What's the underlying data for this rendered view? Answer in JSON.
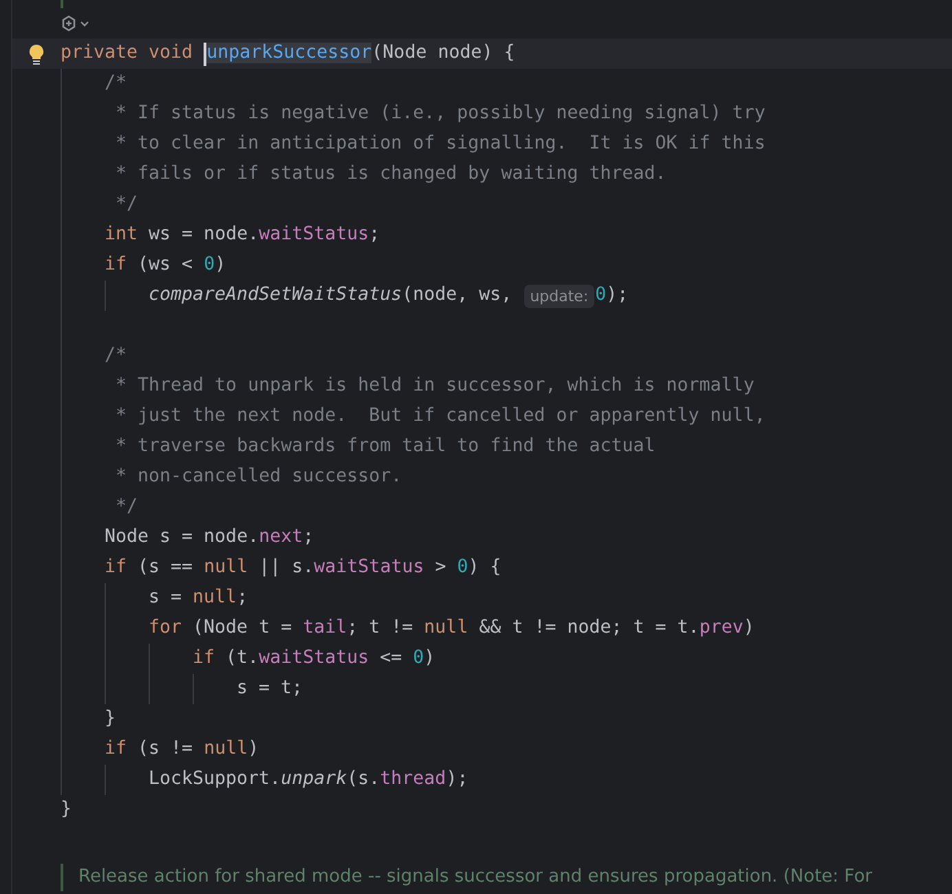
{
  "method": {
    "header": [
      {
        "kind": "keyword",
        "text": "private void "
      },
      {
        "kind": "caret"
      },
      {
        "kind": "declaration",
        "text": "unparkSuccessor",
        "selected": true
      },
      {
        "kind": "plain",
        "text": "(Node node) {"
      }
    ],
    "body": [
      {
        "kind": "code",
        "tokens": [
          {
            "kind": "comment",
            "text": "/*"
          }
        ]
      },
      {
        "kind": "code",
        "tokens": [
          {
            "kind": "comment",
            "text": " * If status is negative (i.e., possibly needing signal) try"
          }
        ]
      },
      {
        "kind": "code",
        "tokens": [
          {
            "kind": "comment",
            "text": " * to clear in anticipation of signalling.  It is OK if this"
          }
        ]
      },
      {
        "kind": "code",
        "tokens": [
          {
            "kind": "comment",
            "text": " * fails or if status is changed by waiting thread."
          }
        ]
      },
      {
        "kind": "code",
        "tokens": [
          {
            "kind": "comment",
            "text": " */"
          }
        ]
      },
      {
        "kind": "code",
        "tokens": [
          {
            "kind": "keyword",
            "text": "int "
          },
          {
            "kind": "plain",
            "text": "ws = node."
          },
          {
            "kind": "field",
            "text": "waitStatus"
          },
          {
            "kind": "plain",
            "text": ";"
          }
        ]
      },
      {
        "kind": "code",
        "tokens": [
          {
            "kind": "keyword",
            "text": "if "
          },
          {
            "kind": "plain",
            "text": "(ws < "
          },
          {
            "kind": "number",
            "text": "0"
          },
          {
            "kind": "plain",
            "text": ")"
          }
        ],
        "children": [
          {
            "kind": "code",
            "tokens": [
              {
                "kind": "static",
                "text": "compareAndSetWaitStatus"
              },
              {
                "kind": "plain",
                "text": "(node, ws, "
              },
              {
                "kind": "hint",
                "text": "update:"
              },
              {
                "kind": "number",
                "text": "0"
              },
              {
                "kind": "plain",
                "text": ");"
              }
            ]
          }
        ]
      },
      {
        "kind": "blank"
      },
      {
        "kind": "code",
        "tokens": [
          {
            "kind": "comment",
            "text": "/*"
          }
        ]
      },
      {
        "kind": "code",
        "tokens": [
          {
            "kind": "comment",
            "text": " * Thread to unpark is held in successor, which is normally"
          }
        ]
      },
      {
        "kind": "code",
        "tokens": [
          {
            "kind": "comment",
            "text": " * just the next node.  But if cancelled or apparently null,"
          }
        ]
      },
      {
        "kind": "code",
        "tokens": [
          {
            "kind": "comment",
            "text": " * traverse backwards from tail to find the actual"
          }
        ]
      },
      {
        "kind": "code",
        "tokens": [
          {
            "kind": "comment",
            "text": " * non-cancelled successor."
          }
        ]
      },
      {
        "kind": "code",
        "tokens": [
          {
            "kind": "comment",
            "text": " */"
          }
        ]
      },
      {
        "kind": "code",
        "tokens": [
          {
            "kind": "plain",
            "text": "Node s = node."
          },
          {
            "kind": "field",
            "text": "next"
          },
          {
            "kind": "plain",
            "text": ";"
          }
        ]
      },
      {
        "kind": "code",
        "tokens": [
          {
            "kind": "keyword",
            "text": "if "
          },
          {
            "kind": "plain",
            "text": "(s == "
          },
          {
            "kind": "keyword",
            "text": "null"
          },
          {
            "kind": "plain",
            "text": " || s."
          },
          {
            "kind": "field",
            "text": "waitStatus"
          },
          {
            "kind": "plain",
            "text": " > "
          },
          {
            "kind": "number",
            "text": "0"
          },
          {
            "kind": "plain",
            "text": ") {"
          }
        ],
        "children": [
          {
            "kind": "code",
            "tokens": [
              {
                "kind": "plain",
                "text": "s = "
              },
              {
                "kind": "keyword",
                "text": "null"
              },
              {
                "kind": "plain",
                "text": ";"
              }
            ]
          },
          {
            "kind": "code",
            "tokens": [
              {
                "kind": "keyword",
                "text": "for "
              },
              {
                "kind": "plain",
                "text": "(Node t = "
              },
              {
                "kind": "field",
                "text": "tail"
              },
              {
                "kind": "plain",
                "text": "; t != "
              },
              {
                "kind": "keyword",
                "text": "null"
              },
              {
                "kind": "plain",
                "text": " && t != node; t = t."
              },
              {
                "kind": "field",
                "text": "prev"
              },
              {
                "kind": "plain",
                "text": ")"
              }
            ],
            "children": [
              {
                "kind": "code",
                "tokens": [
                  {
                    "kind": "keyword",
                    "text": "if "
                  },
                  {
                    "kind": "plain",
                    "text": "(t."
                  },
                  {
                    "kind": "field",
                    "text": "waitStatus"
                  },
                  {
                    "kind": "plain",
                    "text": " <= "
                  },
                  {
                    "kind": "number",
                    "text": "0"
                  },
                  {
                    "kind": "plain",
                    "text": ")"
                  }
                ],
                "children": [
                  {
                    "kind": "code",
                    "tokens": [
                      {
                        "kind": "plain",
                        "text": "s = t;"
                      }
                    ]
                  }
                ]
              }
            ]
          }
        ]
      },
      {
        "kind": "code",
        "tokens": [
          {
            "kind": "plain",
            "text": "}"
          }
        ]
      },
      {
        "kind": "code",
        "tokens": [
          {
            "kind": "keyword",
            "text": "if "
          },
          {
            "kind": "plain",
            "text": "(s != "
          },
          {
            "kind": "keyword",
            "text": "null"
          },
          {
            "kind": "plain",
            "text": ")"
          }
        ],
        "children": [
          {
            "kind": "code",
            "tokens": [
              {
                "kind": "plain",
                "text": "LockSupport."
              },
              {
                "kind": "static",
                "text": "unpark"
              },
              {
                "kind": "plain",
                "text": "(s."
              },
              {
                "kind": "field",
                "text": "thread"
              },
              {
                "kind": "plain",
                "text": ");"
              }
            ]
          }
        ]
      }
    ],
    "closing": "}"
  },
  "doc_bottom": "Release action for shared mode -- signals successor and ensures propagation. (Note: For"
}
